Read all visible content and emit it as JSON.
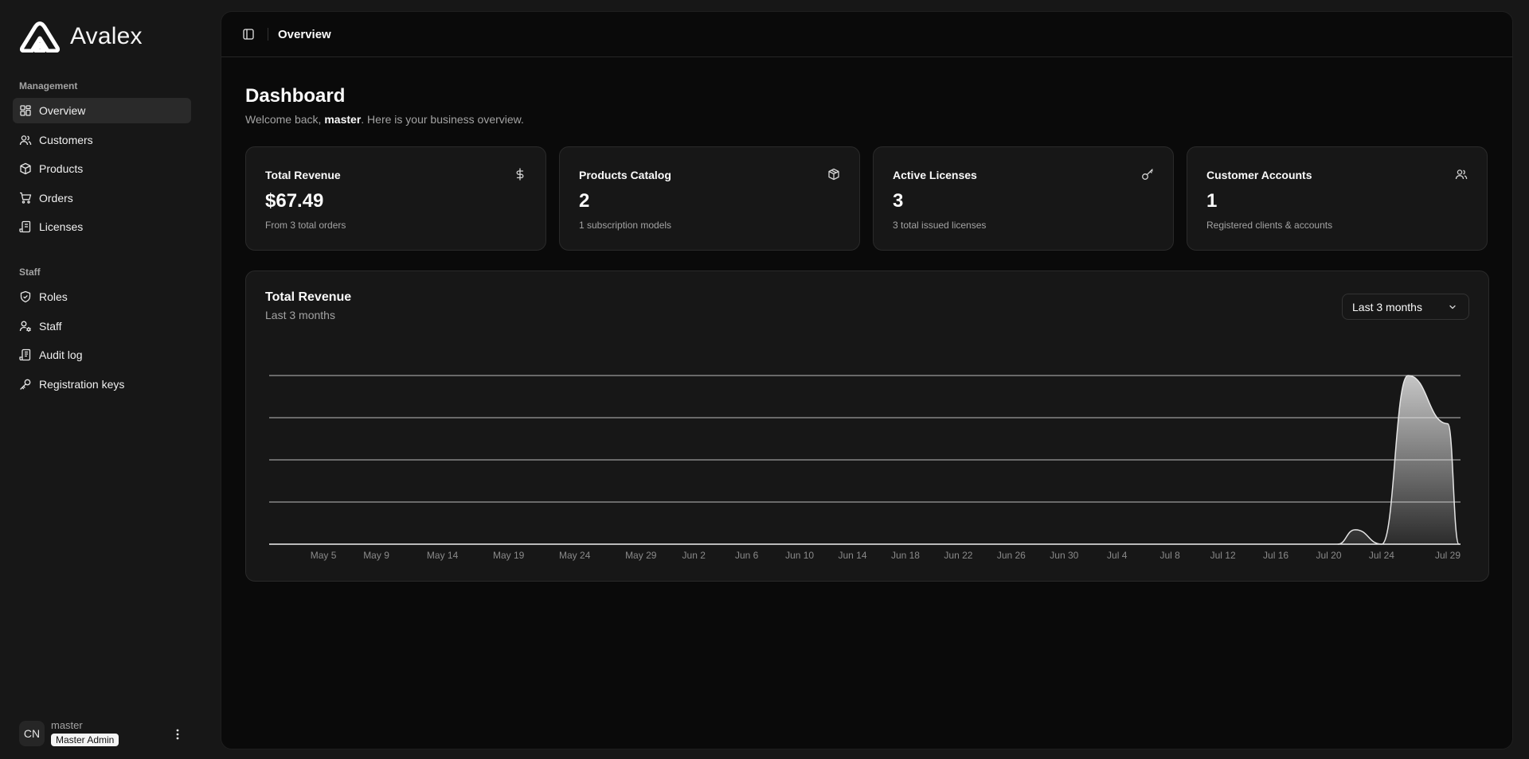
{
  "brand": {
    "name": "Avalex"
  },
  "sidebar": {
    "groups": [
      {
        "label": "Management",
        "items": [
          {
            "label": "Overview",
            "icon": "grid-icon",
            "active": true
          },
          {
            "label": "Customers",
            "icon": "users-icon"
          },
          {
            "label": "Products",
            "icon": "box-icon"
          },
          {
            "label": "Orders",
            "icon": "cart-icon"
          },
          {
            "label": "Licenses",
            "icon": "scroll-icon"
          }
        ]
      },
      {
        "label": "Staff",
        "items": [
          {
            "label": "Roles",
            "icon": "shield-icon"
          },
          {
            "label": "Staff",
            "icon": "user-cog-icon"
          },
          {
            "label": "Audit log",
            "icon": "scroll-text-icon"
          },
          {
            "label": "Registration keys",
            "icon": "key-icon"
          }
        ]
      }
    ],
    "user": {
      "initials": "CN",
      "name": "master",
      "role": "Master Admin"
    }
  },
  "topbar": {
    "title": "Overview"
  },
  "dashboard": {
    "title": "Dashboard",
    "welcome_prefix": "Welcome back, ",
    "welcome_user": "master",
    "welcome_suffix": ". Here is your business overview."
  },
  "cards": [
    {
      "title": "Total Revenue",
      "icon": "dollar-icon",
      "value": "$67.49",
      "sub": "From 3 total orders"
    },
    {
      "title": "Products Catalog",
      "icon": "package-icon",
      "value": "2",
      "sub": "1 subscription models"
    },
    {
      "title": "Active Licenses",
      "icon": "key-icon",
      "value": "3",
      "sub": "3 total issued licenses"
    },
    {
      "title": "Customer Accounts",
      "icon": "users-icon",
      "value": "1",
      "sub": "Registered clients & accounts"
    }
  ],
  "revenue_chart": {
    "title": "Total Revenue",
    "subtitle": "Last 3 months",
    "range_label": "Last 3 months"
  },
  "chart_data": {
    "type": "area",
    "title": "Total Revenue",
    "subtitle": "Last 3 months",
    "x_tick_labels": [
      "May 5",
      "May 9",
      "May 14",
      "May 19",
      "May 24",
      "May 29",
      "Jun 2",
      "Jun 6",
      "Jun 10",
      "Jun 14",
      "Jun 18",
      "Jun 22",
      "Jun 26",
      "Jun 30",
      "Jul 4",
      "Jul 8",
      "Jul 12",
      "Jul 16",
      "Jul 20",
      "Jul 24",
      "Jul 29"
    ],
    "x": [
      "Jul 22",
      "Jul 24",
      "Jul 26",
      "Jul 29"
    ],
    "values": [
      3,
      0,
      35,
      25
    ],
    "ylim": [
      0,
      35
    ],
    "grid": true,
    "color": "#e5e5e5"
  }
}
